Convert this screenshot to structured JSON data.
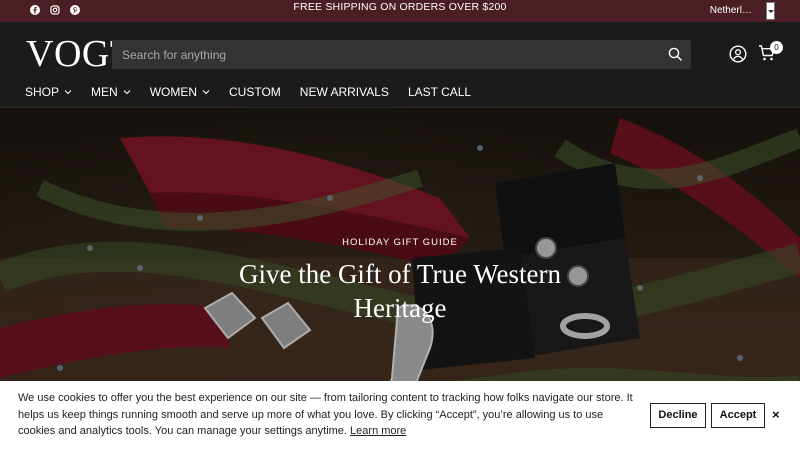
{
  "announcement": {
    "text": "FREE SHIPPING ON ORDERS OVER $200",
    "social_icons": [
      "facebook-icon",
      "instagram-icon",
      "pinterest-icon"
    ],
    "country_label": "Netherl…"
  },
  "header": {
    "logo": "VOGT",
    "search_placeholder": "Search for anything",
    "cart_count": "0",
    "nav": [
      {
        "label": "SHOP",
        "dropdown": true
      },
      {
        "label": "MEN",
        "dropdown": true
      },
      {
        "label": "WOMEN",
        "dropdown": true
      },
      {
        "label": "CUSTOM",
        "dropdown": false
      },
      {
        "label": "NEW ARRIVALS",
        "dropdown": false
      },
      {
        "label": "LAST CALL",
        "dropdown": false
      }
    ]
  },
  "hero": {
    "eyebrow": "HOLIDAY GIFT GUIDE",
    "headline": "Give the Gift of True Western Heritage"
  },
  "cookie_banner": {
    "text": "We use cookies to offer you the best experience on our site — from tailoring content to tracking how folks navigate our store. It helps us keep things running smooth and serve up more of what you love. By clicking “Accept”, you’re allowing us to use cookies and analytics tools. You can manage your settings anytime.",
    "learn_more": "Learn more",
    "decline": "Decline",
    "accept": "Accept",
    "close": "×"
  },
  "colors": {
    "announcement_bg": "#4a1e24",
    "header_bg": "#1b1b1b",
    "search_bg": "#333333",
    "banner_bg": "#ffffff"
  }
}
